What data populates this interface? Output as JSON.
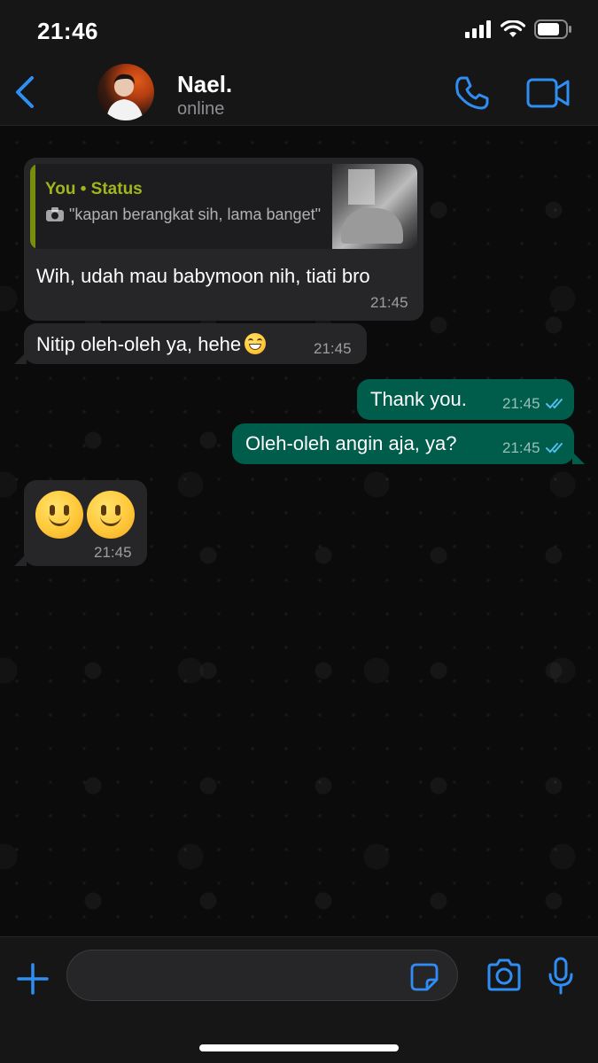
{
  "status_bar": {
    "time": "21:46"
  },
  "header": {
    "contact_name": "Nael.",
    "contact_status": "online",
    "accent_color": "#2f8ef3"
  },
  "messages": [
    {
      "direction": "incoming",
      "quote": {
        "author": "You • Status",
        "text": "\"kapan berangkat sih, lama banget\""
      },
      "text": "Wih, udah mau babymoon nih, tiati bro",
      "time": "21:45"
    },
    {
      "direction": "incoming",
      "text": "Nitip oleh-oleh ya, hehe",
      "emoji": "grinning-face",
      "time": "21:45"
    },
    {
      "direction": "outgoing",
      "text": "Thank you.",
      "time": "21:45",
      "read": true
    },
    {
      "direction": "outgoing",
      "text": "Oleh-oleh angin aja, ya?",
      "time": "21:45",
      "read": true
    },
    {
      "direction": "incoming",
      "emojis": [
        "slightly-smiling-face",
        "slightly-smiling-face"
      ],
      "time": "21:45"
    }
  ],
  "composer": {
    "input_value": "",
    "input_placeholder": ""
  },
  "colors": {
    "incoming_bubble": "#262628",
    "outgoing_bubble": "#005c4b",
    "quote_author": "#a3b51c",
    "read_ticks": "#53bdeb"
  }
}
